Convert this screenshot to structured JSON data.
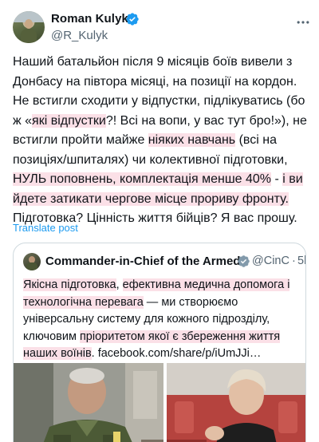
{
  "tweet": {
    "author_name": "Roman Kulyk",
    "author_handle": "@R_Kulyk",
    "text_segments": [
      {
        "text": "Наший батальйон після 9 місяців боїв вивели з Донбасу на півтора місяці, на позиції на кордон. Не встигли сходити у відпустки, підлікуватись (бо ж «",
        "hl": false
      },
      {
        "text": "які відпустки",
        "hl": true
      },
      {
        "text": "?! Всі на вопи, у вас тут бро!»), не встигли пройти майже ",
        "hl": false
      },
      {
        "text": "ніяких навчань",
        "hl": true
      },
      {
        "text": " (всі на позиціях/шпиталях) чи колективної підготовки, ",
        "hl": false
      },
      {
        "text": "НУЛЬ поповнень, комплектація менше 40%",
        "hl": true
      },
      {
        "text": " - ",
        "hl": false
      },
      {
        "text": "і ви йдете затикати чергове місце прориву фронту.",
        "hl": true
      },
      {
        "text": " Підготовка? Цінність життя бійців? Я вас прошу.",
        "hl": false
      }
    ],
    "translate_label": "Translate post"
  },
  "quote": {
    "author_name": "Commander-in-Chief of the Armed",
    "author_handle": "@CinC",
    "separator": "·",
    "time": "5h",
    "text_segments": [
      {
        "text": "Якісна підготовка",
        "hl": true
      },
      {
        "text": ", ",
        "hl": false
      },
      {
        "text": "ефективна медична допомога і технологічна перевага",
        "hl": true
      },
      {
        "text": " — ми створюємо універсальну систему для кожного підрозділу, ключовим ",
        "hl": false
      },
      {
        "text": "пріоритетом якої є збереження життя наших воїнів",
        "hl": true
      },
      {
        "text": ". facebook.com/share/p/iUmJJi…",
        "hl": false
      }
    ]
  },
  "icons": {
    "verified": "verified-badge-icon",
    "more": "more-options-icon"
  },
  "colors": {
    "accent": "#1d9bf0",
    "highlight": "#fbe0e7",
    "text": "#0f1419",
    "secondary": "#536471"
  }
}
